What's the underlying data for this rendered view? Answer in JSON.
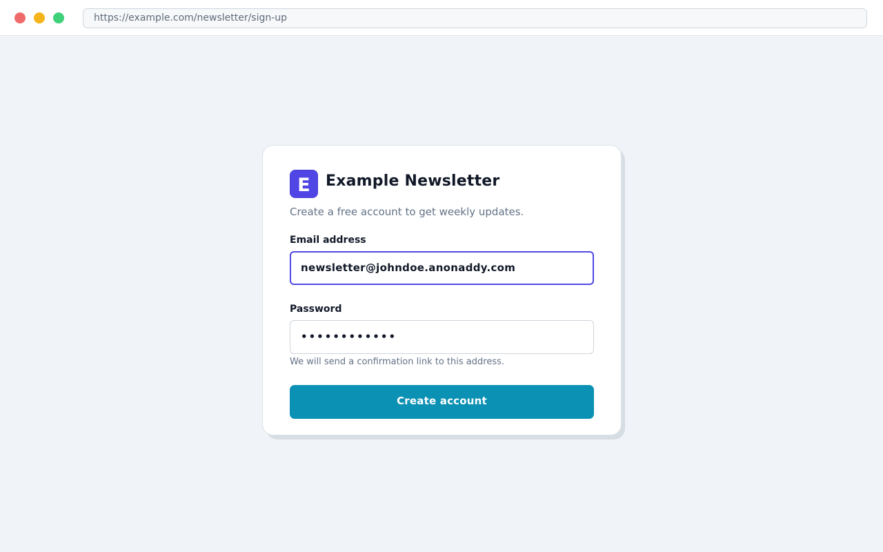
{
  "browser": {
    "url": "https://example.com/newsletter/sign-up",
    "window_controls": [
      "close-dot",
      "minimize-dot",
      "maximize-dot"
    ]
  },
  "card": {
    "logo_letter": "E",
    "title": "Example Newsletter",
    "subtitle": "Create a free account to get weekly updates.",
    "email": {
      "label": "Email address",
      "value": "newsletter@johndoe.anonaddy.com"
    },
    "password": {
      "label": "Password",
      "value": "••••••••••••"
    },
    "helper_text": "We will send a confirmation link to this address.",
    "submit_label": "Create account"
  },
  "colors": {
    "background": "#f0f3f8",
    "accent": "#4f46e5",
    "button": "#0b91b3",
    "close": "#ef6b6b",
    "minimize": "#f4b41a",
    "maximize": "#3fd07a"
  }
}
